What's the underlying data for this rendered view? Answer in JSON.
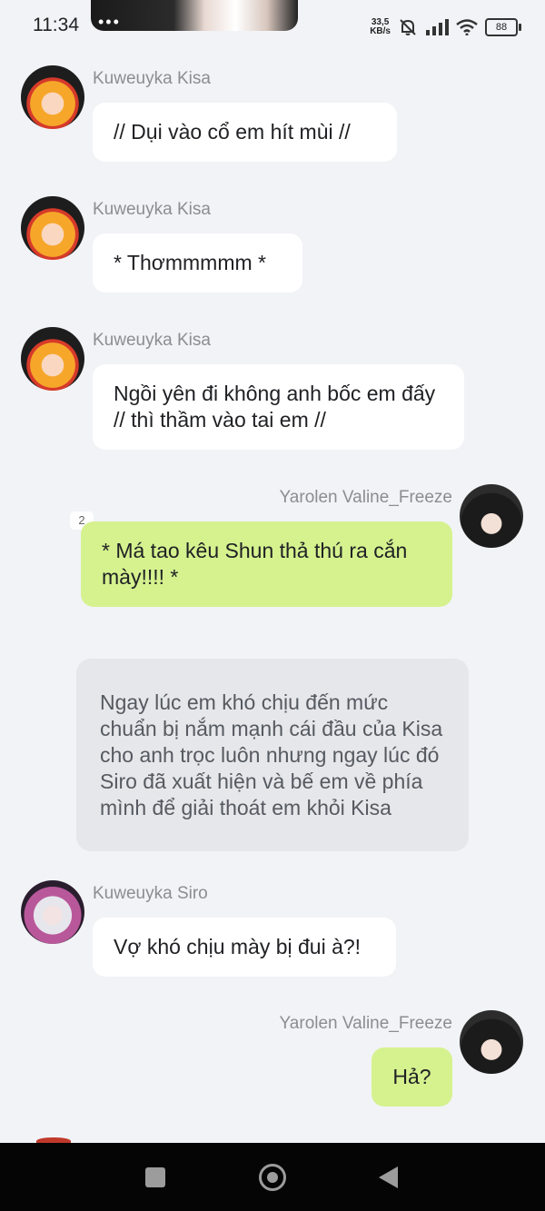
{
  "status_bar": {
    "time": "11:34",
    "notch_dots": "•••",
    "net_speed_value": "33,5",
    "net_speed_unit": "KB/s",
    "battery": "88"
  },
  "messages": [
    {
      "sender": "Kuweuyka Kisa",
      "text": "// Dụi vào cổ em hít mùi //"
    },
    {
      "sender": "Kuweuyka Kisa",
      "text": "* Thơmmmmm *"
    },
    {
      "sender": "Kuweuyka Kisa",
      "text": "Ngồi yên đi không anh bốc em đấy // thì  thầm vào tai em //"
    },
    {
      "sender": "Yarolen Valine_Freeze",
      "text": "* Má tao kêu Shun thả thú ra cắn mày!!!! *",
      "badge": "2"
    },
    {
      "narration": "Ngay lúc em khó chịu đến mức chuẩn bị nắm mạnh cái đầu của Kisa cho anh trọc luôn nhưng ngay lúc đó Siro đã xuất hiện và bế em về phía mình để giải thoát em khỏi Kisa"
    },
    {
      "sender": "Kuweuyka Siro",
      "text": "Vợ khó chịu mày bị đui à?!"
    },
    {
      "sender": "Yarolen Valine_Freeze",
      "text": "Hả?"
    }
  ],
  "colors": {
    "background": "#f2f3f6",
    "bubble_in": "#ffffff",
    "bubble_out": "#d5f28f",
    "narration": "#e6e7ea",
    "name": "#8a8d93"
  },
  "icons": [
    "mute-bell-icon",
    "signal-icon",
    "wifi-icon",
    "battery-icon",
    "recents-icon",
    "home-icon",
    "back-icon"
  ]
}
